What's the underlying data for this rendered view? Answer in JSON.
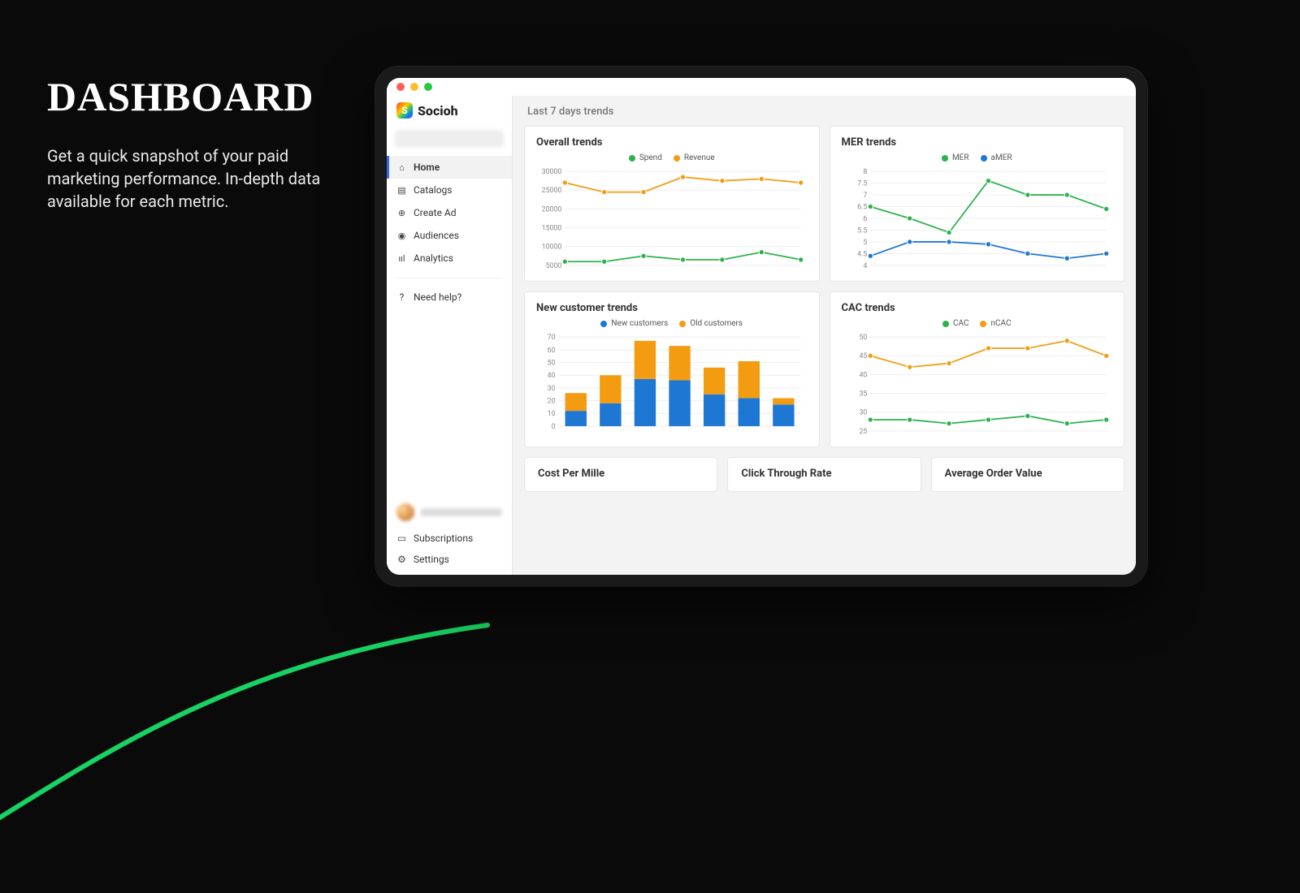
{
  "hero": {
    "title": "DASHBOARD",
    "subtitle": "Get a quick snapshot of your paid marketing performance. In-depth data available for each metric."
  },
  "brand": {
    "name": "Socioh",
    "mark": "S"
  },
  "sidebar": {
    "items": [
      {
        "label": "Home",
        "active": true
      },
      {
        "label": "Catalogs"
      },
      {
        "label": "Create Ad"
      },
      {
        "label": "Audiences"
      },
      {
        "label": "Analytics"
      }
    ],
    "help_label": "Need help?",
    "bottom": [
      {
        "label": "Subscriptions"
      },
      {
        "label": "Settings"
      }
    ]
  },
  "main": {
    "header": "Last 7 days trends",
    "cards": {
      "overall": {
        "title": "Overall trends"
      },
      "mer": {
        "title": "MER trends"
      },
      "newcust": {
        "title": "New customer trends"
      },
      "cac": {
        "title": "CAC trends"
      },
      "cpm": {
        "title": "Cost Per Mille"
      },
      "ctr": {
        "title": "Click Through Rate"
      },
      "aov": {
        "title": "Average Order Value"
      }
    }
  },
  "colors": {
    "green": "#2bb24c",
    "orange": "#f39c12",
    "blue": "#1f77d4",
    "blue2": "#1f77d4"
  },
  "chart_data": [
    {
      "id": "overall",
      "type": "line",
      "title": "Overall trends",
      "x": [
        1,
        2,
        3,
        4,
        5,
        6,
        7
      ],
      "ylim": [
        5000,
        30000
      ],
      "yticks": [
        5000,
        10000,
        15000,
        20000,
        25000,
        30000
      ],
      "series": [
        {
          "name": "Spend",
          "color_key": "green",
          "values": [
            6000,
            6000,
            7500,
            6500,
            6500,
            8500,
            6500
          ]
        },
        {
          "name": "Revenue",
          "color_key": "orange",
          "values": [
            27000,
            24500,
            24500,
            28500,
            27500,
            28000,
            27000
          ]
        }
      ]
    },
    {
      "id": "mer",
      "type": "line",
      "title": "MER trends",
      "x": [
        1,
        2,
        3,
        4,
        5,
        6,
        7
      ],
      "ylim": [
        4.0,
        8.0
      ],
      "yticks": [
        4.0,
        4.5,
        5.0,
        5.5,
        6.0,
        6.5,
        7.0,
        7.5,
        8.0
      ],
      "series": [
        {
          "name": "MER",
          "color_key": "green",
          "values": [
            6.5,
            6.0,
            5.4,
            7.6,
            7.0,
            7.0,
            6.4
          ]
        },
        {
          "name": "aMER",
          "color_key": "blue",
          "values": [
            4.4,
            5.0,
            5.0,
            4.9,
            4.5,
            4.3,
            4.5
          ]
        }
      ]
    },
    {
      "id": "newcust",
      "type": "bar",
      "stacked": true,
      "title": "New customer trends",
      "categories": [
        1,
        2,
        3,
        4,
        5,
        6,
        7
      ],
      "ylim": [
        0,
        70
      ],
      "yticks": [
        0,
        10,
        20,
        30,
        40,
        50,
        60,
        70
      ],
      "series": [
        {
          "name": "New customers",
          "color_key": "blue",
          "values": [
            12,
            18,
            37,
            36,
            25,
            22,
            17
          ]
        },
        {
          "name": "Old customers",
          "color_key": "orange",
          "values": [
            14,
            22,
            30,
            27,
            21,
            29,
            5
          ]
        }
      ]
    },
    {
      "id": "cac",
      "type": "line",
      "title": "CAC trends",
      "x": [
        1,
        2,
        3,
        4,
        5,
        6,
        7
      ],
      "ylim": [
        25,
        50
      ],
      "yticks": [
        25,
        30,
        35,
        40,
        45,
        50
      ],
      "series": [
        {
          "name": "CAC",
          "color_key": "green",
          "values": [
            28,
            28,
            27,
            28,
            29,
            27,
            28
          ]
        },
        {
          "name": "nCAC",
          "color_key": "orange",
          "values": [
            45,
            42,
            43,
            47,
            47,
            49,
            45
          ]
        }
      ]
    }
  ]
}
